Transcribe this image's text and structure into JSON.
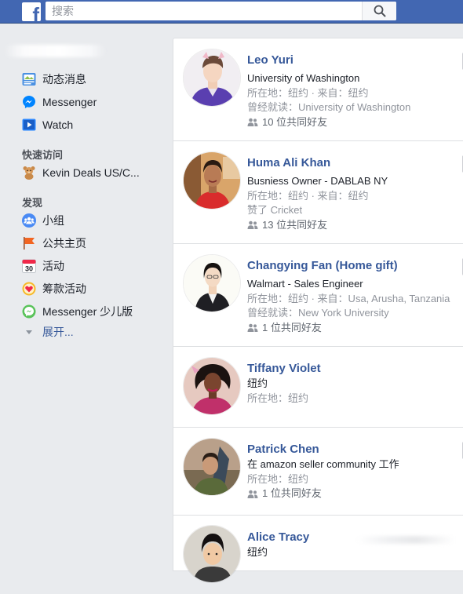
{
  "header": {
    "logo_letter": "f",
    "search_placeholder": "搜索"
  },
  "sidebar": {
    "main_items": [
      {
        "label": "动态消息",
        "icon": "news-feed-icon"
      },
      {
        "label": "Messenger",
        "icon": "messenger-icon"
      },
      {
        "label": "Watch",
        "icon": "watch-icon"
      }
    ],
    "shortcuts_title": "快速访问",
    "shortcuts": [
      {
        "label": "Kevin Deals US/C...",
        "icon": "teddy-bear-icon"
      }
    ],
    "explore_title": "发现",
    "explore_items": [
      {
        "label": "小组",
        "icon": "groups-icon"
      },
      {
        "label": "公共主页",
        "icon": "pages-flag-icon"
      },
      {
        "label": "活动",
        "icon": "events-calendar-icon"
      },
      {
        "label": "筹款活动",
        "icon": "fundraiser-heart-icon"
      },
      {
        "label": "Messenger 少儿版",
        "icon": "messenger-kids-icon"
      }
    ],
    "more_label": "展开..."
  },
  "people": [
    {
      "name": "Leo Yuri",
      "lines": [
        "University of Washington",
        "所在地：纽约 · 来自：纽约",
        "曾经就读：University of Washington"
      ],
      "mutual": "10 位共同好友"
    },
    {
      "name": "Huma Ali Khan",
      "lines": [
        "Busniess Owner - DABLAB NY",
        "所在地：纽约 · 来自：纽约",
        "赞了 Cricket"
      ],
      "mutual": "13 位共同好友"
    },
    {
      "name": "Changying Fan (Home gift)",
      "lines": [
        "Walmart - Sales Engineer",
        "所在地：纽约 · 来自：Usa, Arusha, Tanzania",
        "曾经就读：New York University"
      ],
      "mutual": "1 位共同好友"
    },
    {
      "name": "Tiffany Violet",
      "lines": [
        "纽约",
        "所在地：纽约"
      ],
      "mutual": ""
    },
    {
      "name": "Patrick Chen",
      "lines": [
        "在 amazon seller community 工作",
        "所在地：纽约"
      ],
      "mutual": "1 位共同好友"
    },
    {
      "name": "Alice Tracy",
      "lines": [
        "纽约"
      ],
      "mutual": ""
    }
  ],
  "colors": {
    "brand_blue": "#4267b2",
    "link_blue": "#365899",
    "background": "#e9ebee"
  }
}
